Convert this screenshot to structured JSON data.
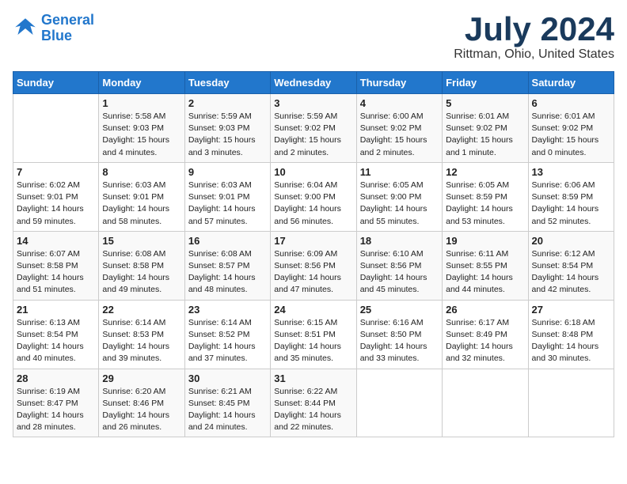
{
  "logo": {
    "line1": "General",
    "line2": "Blue"
  },
  "title": "July 2024",
  "location": "Rittman, Ohio, United States",
  "headers": [
    "Sunday",
    "Monday",
    "Tuesday",
    "Wednesday",
    "Thursday",
    "Friday",
    "Saturday"
  ],
  "weeks": [
    [
      {
        "num": "",
        "info": ""
      },
      {
        "num": "1",
        "info": "Sunrise: 5:58 AM\nSunset: 9:03 PM\nDaylight: 15 hours\nand 4 minutes."
      },
      {
        "num": "2",
        "info": "Sunrise: 5:59 AM\nSunset: 9:03 PM\nDaylight: 15 hours\nand 3 minutes."
      },
      {
        "num": "3",
        "info": "Sunrise: 5:59 AM\nSunset: 9:02 PM\nDaylight: 15 hours\nand 2 minutes."
      },
      {
        "num": "4",
        "info": "Sunrise: 6:00 AM\nSunset: 9:02 PM\nDaylight: 15 hours\nand 2 minutes."
      },
      {
        "num": "5",
        "info": "Sunrise: 6:01 AM\nSunset: 9:02 PM\nDaylight: 15 hours\nand 1 minute."
      },
      {
        "num": "6",
        "info": "Sunrise: 6:01 AM\nSunset: 9:02 PM\nDaylight: 15 hours\nand 0 minutes."
      }
    ],
    [
      {
        "num": "7",
        "info": "Sunrise: 6:02 AM\nSunset: 9:01 PM\nDaylight: 14 hours\nand 59 minutes."
      },
      {
        "num": "8",
        "info": "Sunrise: 6:03 AM\nSunset: 9:01 PM\nDaylight: 14 hours\nand 58 minutes."
      },
      {
        "num": "9",
        "info": "Sunrise: 6:03 AM\nSunset: 9:01 PM\nDaylight: 14 hours\nand 57 minutes."
      },
      {
        "num": "10",
        "info": "Sunrise: 6:04 AM\nSunset: 9:00 PM\nDaylight: 14 hours\nand 56 minutes."
      },
      {
        "num": "11",
        "info": "Sunrise: 6:05 AM\nSunset: 9:00 PM\nDaylight: 14 hours\nand 55 minutes."
      },
      {
        "num": "12",
        "info": "Sunrise: 6:05 AM\nSunset: 8:59 PM\nDaylight: 14 hours\nand 53 minutes."
      },
      {
        "num": "13",
        "info": "Sunrise: 6:06 AM\nSunset: 8:59 PM\nDaylight: 14 hours\nand 52 minutes."
      }
    ],
    [
      {
        "num": "14",
        "info": "Sunrise: 6:07 AM\nSunset: 8:58 PM\nDaylight: 14 hours\nand 51 minutes."
      },
      {
        "num": "15",
        "info": "Sunrise: 6:08 AM\nSunset: 8:58 PM\nDaylight: 14 hours\nand 49 minutes."
      },
      {
        "num": "16",
        "info": "Sunrise: 6:08 AM\nSunset: 8:57 PM\nDaylight: 14 hours\nand 48 minutes."
      },
      {
        "num": "17",
        "info": "Sunrise: 6:09 AM\nSunset: 8:56 PM\nDaylight: 14 hours\nand 47 minutes."
      },
      {
        "num": "18",
        "info": "Sunrise: 6:10 AM\nSunset: 8:56 PM\nDaylight: 14 hours\nand 45 minutes."
      },
      {
        "num": "19",
        "info": "Sunrise: 6:11 AM\nSunset: 8:55 PM\nDaylight: 14 hours\nand 44 minutes."
      },
      {
        "num": "20",
        "info": "Sunrise: 6:12 AM\nSunset: 8:54 PM\nDaylight: 14 hours\nand 42 minutes."
      }
    ],
    [
      {
        "num": "21",
        "info": "Sunrise: 6:13 AM\nSunset: 8:54 PM\nDaylight: 14 hours\nand 40 minutes."
      },
      {
        "num": "22",
        "info": "Sunrise: 6:14 AM\nSunset: 8:53 PM\nDaylight: 14 hours\nand 39 minutes."
      },
      {
        "num": "23",
        "info": "Sunrise: 6:14 AM\nSunset: 8:52 PM\nDaylight: 14 hours\nand 37 minutes."
      },
      {
        "num": "24",
        "info": "Sunrise: 6:15 AM\nSunset: 8:51 PM\nDaylight: 14 hours\nand 35 minutes."
      },
      {
        "num": "25",
        "info": "Sunrise: 6:16 AM\nSunset: 8:50 PM\nDaylight: 14 hours\nand 33 minutes."
      },
      {
        "num": "26",
        "info": "Sunrise: 6:17 AM\nSunset: 8:49 PM\nDaylight: 14 hours\nand 32 minutes."
      },
      {
        "num": "27",
        "info": "Sunrise: 6:18 AM\nSunset: 8:48 PM\nDaylight: 14 hours\nand 30 minutes."
      }
    ],
    [
      {
        "num": "28",
        "info": "Sunrise: 6:19 AM\nSunset: 8:47 PM\nDaylight: 14 hours\nand 28 minutes."
      },
      {
        "num": "29",
        "info": "Sunrise: 6:20 AM\nSunset: 8:46 PM\nDaylight: 14 hours\nand 26 minutes."
      },
      {
        "num": "30",
        "info": "Sunrise: 6:21 AM\nSunset: 8:45 PM\nDaylight: 14 hours\nand 24 minutes."
      },
      {
        "num": "31",
        "info": "Sunrise: 6:22 AM\nSunset: 8:44 PM\nDaylight: 14 hours\nand 22 minutes."
      },
      {
        "num": "",
        "info": ""
      },
      {
        "num": "",
        "info": ""
      },
      {
        "num": "",
        "info": ""
      }
    ]
  ]
}
